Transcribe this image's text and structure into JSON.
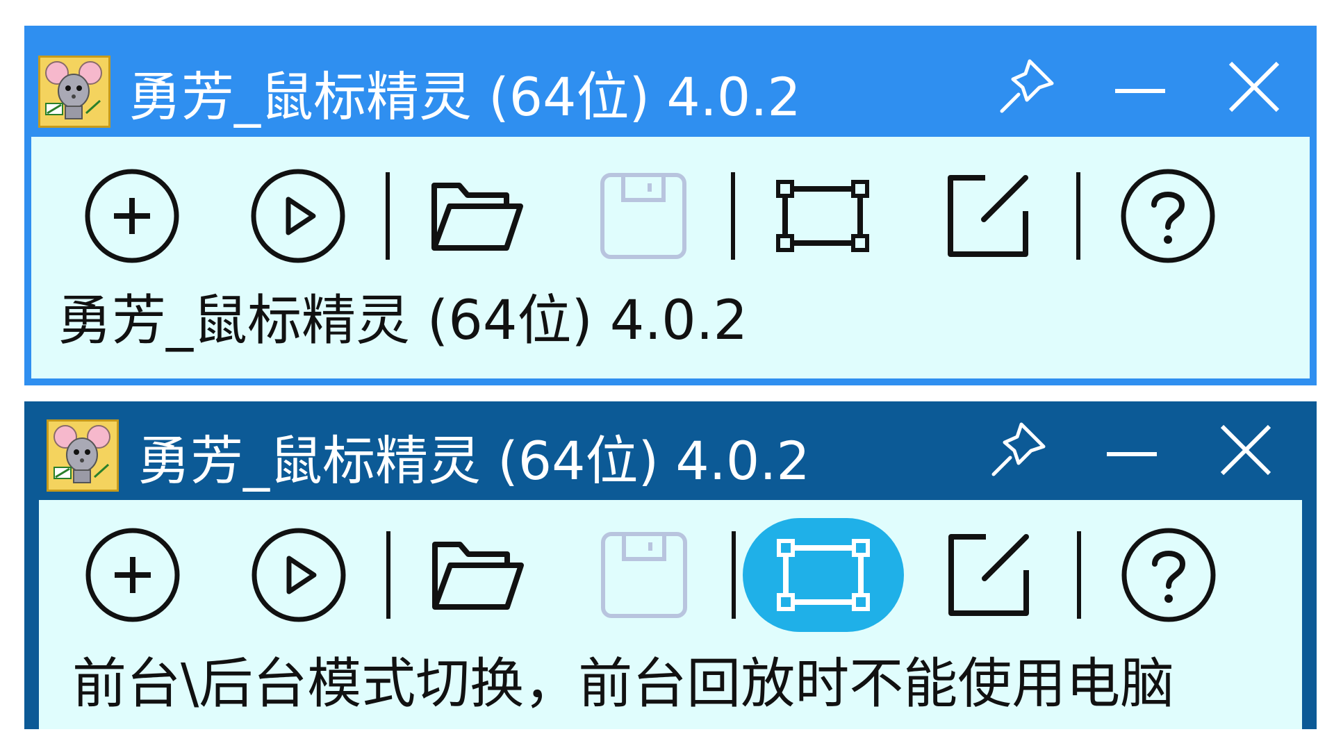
{
  "colors": {
    "window1_titlebar": "#2f8ff0",
    "window2_titlebar": "#0c5a96",
    "client_background": "#e0fdfd",
    "active_tool_highlight": "#1fb0e8",
    "disabled_icon": "#b8c4de",
    "icon_stroke": "#111111"
  },
  "windows": [
    {
      "title": "勇芳_鼠标精灵 (64位) 4.0.2",
      "app_icon": "mouse-sprite-logo-icon",
      "title_buttons": [
        "pin-icon",
        "minimize-icon",
        "close-icon"
      ],
      "toolbar": [
        {
          "icon": "add-circle-icon",
          "enabled": true
        },
        {
          "icon": "play-circle-icon",
          "enabled": true
        },
        {
          "icon": "open-folder-icon",
          "enabled": true
        },
        {
          "icon": "save-floppy-icon",
          "enabled": false
        },
        {
          "icon": "frame-mode-icon",
          "enabled": true,
          "active": false
        },
        {
          "icon": "edit-box-icon",
          "enabled": true
        },
        {
          "icon": "help-circle-icon",
          "enabled": true
        }
      ],
      "status": "勇芳_鼠标精灵 (64位) 4.0.2"
    },
    {
      "title": "勇芳_鼠标精灵 (64位) 4.0.2",
      "app_icon": "mouse-sprite-logo-icon",
      "title_buttons": [
        "pin-icon",
        "minimize-icon",
        "close-icon"
      ],
      "toolbar": [
        {
          "icon": "add-circle-icon",
          "enabled": true
        },
        {
          "icon": "play-circle-icon",
          "enabled": true
        },
        {
          "icon": "open-folder-icon",
          "enabled": true
        },
        {
          "icon": "save-floppy-icon",
          "enabled": false
        },
        {
          "icon": "frame-mode-icon",
          "enabled": true,
          "active": true
        },
        {
          "icon": "edit-box-icon",
          "enabled": true
        },
        {
          "icon": "help-circle-icon",
          "enabled": true
        }
      ],
      "status": "前台\\后台模式切换，前台回放时不能使用电脑"
    }
  ]
}
